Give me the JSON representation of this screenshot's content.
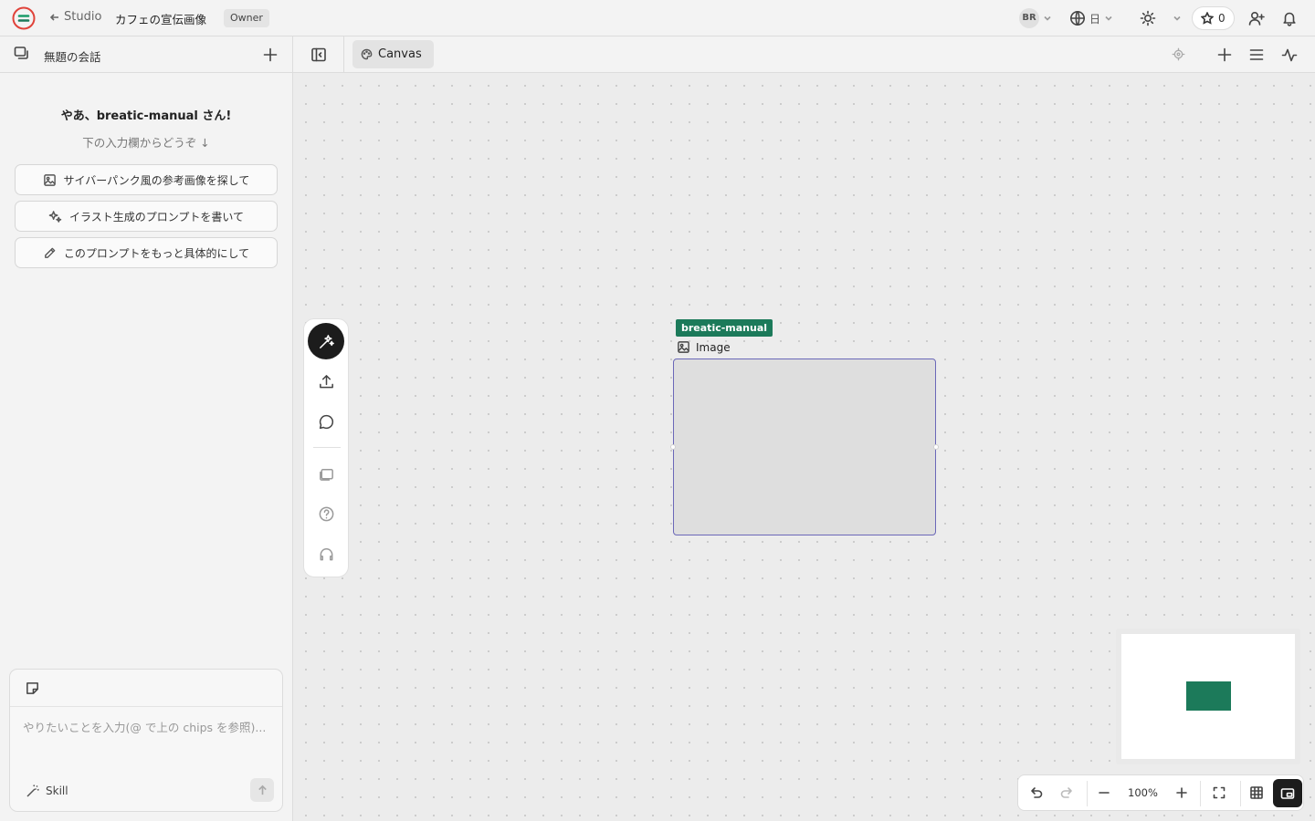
{
  "header": {
    "back_label": "Studio",
    "project_title": "カフェの宣伝画像",
    "role_badge": "Owner",
    "user_initials": "BR",
    "language": "日",
    "star_count": "0"
  },
  "sidebar": {
    "conversation_title": "無題の会話",
    "greeting": "やあ、breatic-manual さん!",
    "subgreeting": "下の入力欄からどうぞ ↓",
    "chips": [
      {
        "label": "サイバーパンク風の参考画像を探して",
        "icon": "image-search-icon"
      },
      {
        "label": "イラスト生成のプロンプトを書いて",
        "icon": "sparkles-icon"
      },
      {
        "label": "このプロンプトをもっと具体的にして",
        "icon": "pencil-icon"
      }
    ],
    "composer": {
      "placeholder": "やりたいことを入力(@ で上の chips を参照)...",
      "skill_label": "Skill"
    }
  },
  "canvas": {
    "tab_label": "Canvas",
    "node": {
      "owner_badge": "breatic-manual",
      "type_label": "Image"
    },
    "zoom_level": "100%"
  },
  "colors": {
    "accent_green": "#1c7a5a",
    "selection_purple": "#6b68b8",
    "active_dark": "#1c1c1c"
  }
}
